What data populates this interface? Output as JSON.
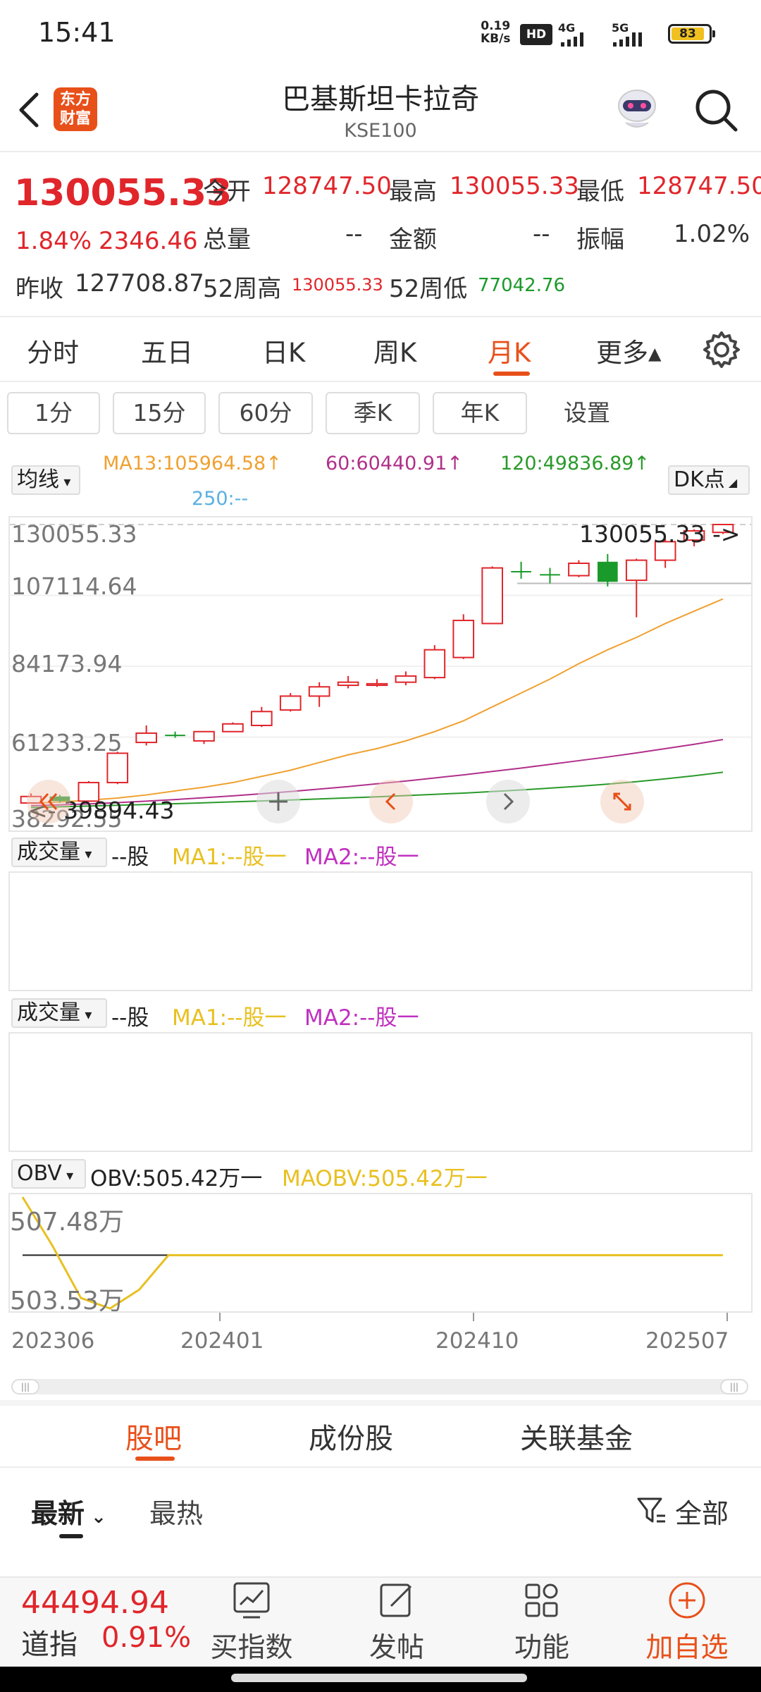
{
  "status_bar": {
    "time": "15:41",
    "net_speed_value": "0.19",
    "net_speed_unit": "KB/s",
    "hd": "HD",
    "sig1": "4G",
    "sig2": "5G",
    "battery": "83"
  },
  "header": {
    "logo": "东方财富",
    "title": "巴基斯坦卡拉奇",
    "subtitle": "KSE100",
    "icons": [
      "back-arrow-icon",
      "robot-avatar-icon",
      "search-icon"
    ]
  },
  "quote": {
    "price": "130055.33",
    "change_pct": "1.84%",
    "change_abs": "2346.46",
    "open_label": "今开",
    "open": "128747.50",
    "high_label": "最高",
    "high": "130055.33",
    "low_label": "最低",
    "low": "128747.50",
    "volume_label": "总量",
    "volume": "--",
    "amount_label": "金额",
    "amount": "--",
    "amplitude_label": "振幅",
    "amplitude": "1.02%",
    "prev_close_label": "昨收",
    "prev_close": "127708.87",
    "high52_label": "52周高",
    "high52": "130055.33",
    "low52_label": "52周低",
    "low52": "77042.76"
  },
  "period_tabs": [
    "分时",
    "五日",
    "日K",
    "周K",
    "月K",
    "更多▴"
  ],
  "active_period": "月K",
  "sub_buttons": [
    "1分",
    "15分",
    "60分",
    "季K",
    "年K",
    "设置"
  ],
  "indicator": {
    "selector": "均线",
    "ma13": "MA13:105964.58↑",
    "ma60": "60:60440.91↑",
    "ma120": "120:49836.89↑",
    "ma250": "250:--",
    "dk": "DK点"
  },
  "chart_labels": {
    "y_ticks": [
      "130055.33",
      "107114.64",
      "84173.94",
      "61233.25",
      "38292.55"
    ],
    "max_marker": "130055.33",
    "min_marker": "39894.43",
    "max_arrow": "->",
    "min_arrow": "<-"
  },
  "volume_panel": {
    "selector": "成交量",
    "unit": "--股",
    "ma1": "MA1:--股一",
    "ma2": "MA2:--股一"
  },
  "obv_panel": {
    "selector": "OBV",
    "obv": "OBV:505.42万一",
    "maobv": "MAOBV:505.42万一",
    "top_label": "507.48万",
    "bottom_label": "503.53万"
  },
  "x_axis": [
    "202306",
    "202401",
    "202410",
    "202507"
  ],
  "chart_data": {
    "type": "candlestick",
    "ylim": [
      38292.55,
      130055.33
    ],
    "candles": [
      {
        "o": 39894.43,
        "c": 42000,
        "h": 43000,
        "l": 39894.43,
        "up": true
      },
      {
        "o": 42000,
        "c": 40500,
        "h": 42500,
        "l": 40000,
        "up": false
      },
      {
        "o": 40500,
        "c": 46500,
        "h": 47000,
        "l": 40200,
        "up": true
      },
      {
        "o": 46500,
        "c": 56000,
        "h": 56500,
        "l": 46000,
        "up": true
      },
      {
        "o": 59500,
        "c": 62500,
        "h": 65000,
        "l": 58500,
        "up": true
      },
      {
        "o": 62000,
        "c": 62000,
        "h": 63000,
        "l": 61000,
        "up": false
      },
      {
        "o": 60000,
        "c": 63000,
        "h": 63000,
        "l": 59000,
        "up": true
      },
      {
        "o": 63000,
        "c": 65500,
        "h": 66000,
        "l": 63000,
        "up": true
      },
      {
        "o": 65000,
        "c": 69500,
        "h": 71000,
        "l": 64500,
        "up": true
      },
      {
        "o": 70000,
        "c": 74500,
        "h": 75500,
        "l": 69500,
        "up": true
      },
      {
        "o": 74500,
        "c": 77500,
        "h": 79000,
        "l": 71000,
        "up": true
      },
      {
        "o": 78000,
        "c": 79000,
        "h": 81000,
        "l": 77000,
        "up": true
      },
      {
        "o": 78000,
        "c": 78500,
        "h": 80000,
        "l": 77500,
        "up": true
      },
      {
        "o": 79000,
        "c": 81000,
        "h": 82500,
        "l": 78000,
        "up": true
      },
      {
        "o": 80500,
        "c": 89500,
        "h": 91000,
        "l": 80000,
        "up": true
      },
      {
        "o": 87000,
        "c": 99000,
        "h": 101000,
        "l": 86500,
        "up": true
      },
      {
        "o": 98000,
        "c": 116000,
        "h": 116500,
        "l": 98000,
        "up": true
      },
      {
        "o": 115000,
        "c": 115000,
        "h": 118000,
        "l": 112500,
        "up": false
      },
      {
        "o": 114000,
        "c": 114000,
        "h": 116000,
        "l": 111000,
        "up": false
      },
      {
        "o": 113500,
        "c": 117500,
        "h": 118500,
        "l": 113000,
        "up": true
      },
      {
        "o": 118000,
        "c": 111500,
        "h": 120500,
        "l": 110000,
        "up": false
      },
      {
        "o": 112000,
        "c": 118500,
        "h": 119000,
        "l": 100000,
        "up": true
      },
      {
        "o": 118500,
        "c": 124500,
        "h": 125500,
        "l": 116000,
        "up": true
      },
      {
        "o": 125000,
        "c": 128000,
        "h": 128500,
        "l": 123000,
        "up": true
      },
      {
        "o": 127500,
        "c": 130055.33,
        "h": 130055.33,
        "l": 127000,
        "up": true
      }
    ],
    "ma13": [
      39800,
      40200,
      40800,
      41500,
      42500,
      43800,
      45000,
      46500,
      48500,
      50500,
      53000,
      55500,
      57500,
      60000,
      63000,
      66500,
      71000,
      75500,
      80000,
      85000,
      89500,
      93500,
      98000,
      102000,
      105964.58
    ],
    "ma60": [
      39000,
      39300,
      39600,
      40000,
      40500,
      41000,
      41600,
      42200,
      42900,
      43600,
      44400,
      45200,
      46100,
      47000,
      48000,
      49000,
      50100,
      51200,
      52400,
      53600,
      54800,
      56100,
      57500,
      58900,
      60440.91
    ],
    "ma120": [
      38400,
      38650,
      38900,
      39150,
      39400,
      39650,
      39950,
      40250,
      40550,
      40850,
      41200,
      41550,
      41900,
      42300,
      42700,
      43100,
      43600,
      44100,
      44700,
      45300,
      46000,
      46800,
      47700,
      48700,
      49836.89
    ]
  },
  "obv_chart": {
    "ylim": [
      503.53,
      507.48
    ],
    "obv": [
      507.48,
      505.8,
      503.9,
      503.53,
      504.2,
      505.42,
      505.42,
      505.42,
      505.42,
      505.42,
      505.42,
      505.42,
      505.42,
      505.42,
      505.42,
      505.42,
      505.42,
      505.42,
      505.42,
      505.42,
      505.42,
      505.42,
      505.42,
      505.42,
      505.42
    ],
    "maobv": [
      505.42,
      505.42,
      505.42,
      505.42,
      505.42,
      505.42,
      505.42,
      505.42,
      505.42,
      505.42,
      505.42,
      505.42,
      505.42,
      505.42,
      505.42,
      505.42,
      505.42,
      505.42,
      505.42,
      505.42,
      505.42,
      505.42,
      505.42,
      505.42,
      505.42
    ]
  },
  "content_tabs": [
    "股吧",
    "成份股",
    "关联基金"
  ],
  "active_content_tab": "股吧",
  "sort_tabs": {
    "latest": "最新",
    "hot": "最热",
    "filter": "全部"
  },
  "footer": {
    "index_value": "44494.94",
    "index_name": "道指",
    "index_change": "0.91%",
    "buttons": [
      "买指数",
      "发帖",
      "功能",
      "加自选"
    ]
  },
  "colors": {
    "up": "#e0262b",
    "down": "#1a9a2a",
    "accent": "#e8501a",
    "ma13": "#f0a030",
    "ma60": "#b0308a",
    "ma120": "#2a9a2a",
    "obv": "#e8c020"
  }
}
